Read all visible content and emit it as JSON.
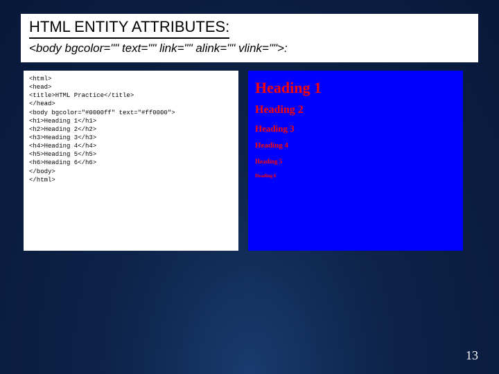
{
  "title": "HTML ENTITY ATTRIBUTES:",
  "subtitle": "<body bgcolor=\"\" text=\"\" link=\"\" alink=\"\" vlink=\"\">:",
  "code": "<html>\n<head>\n<title>HTML Practice</title>\n</head>\n<body bgcolor=\"#0000ff\" text=\"#ff0000\">\n<h1>Heading 1</h1>\n<h2>Heading 2</h2>\n<h3>Heading 3</h3>\n<h4>Heading 4</h4>\n<h5>Heading 5</h5>\n<h6>Heading 6</h6>\n</body>\n</html>",
  "preview": {
    "h1": "Heading 1",
    "h2": "Heading 2",
    "h3": "Heading 3",
    "h4": "Heading 4",
    "h5": "Heading 5",
    "h6": "Heading 6"
  },
  "page_number": "13"
}
